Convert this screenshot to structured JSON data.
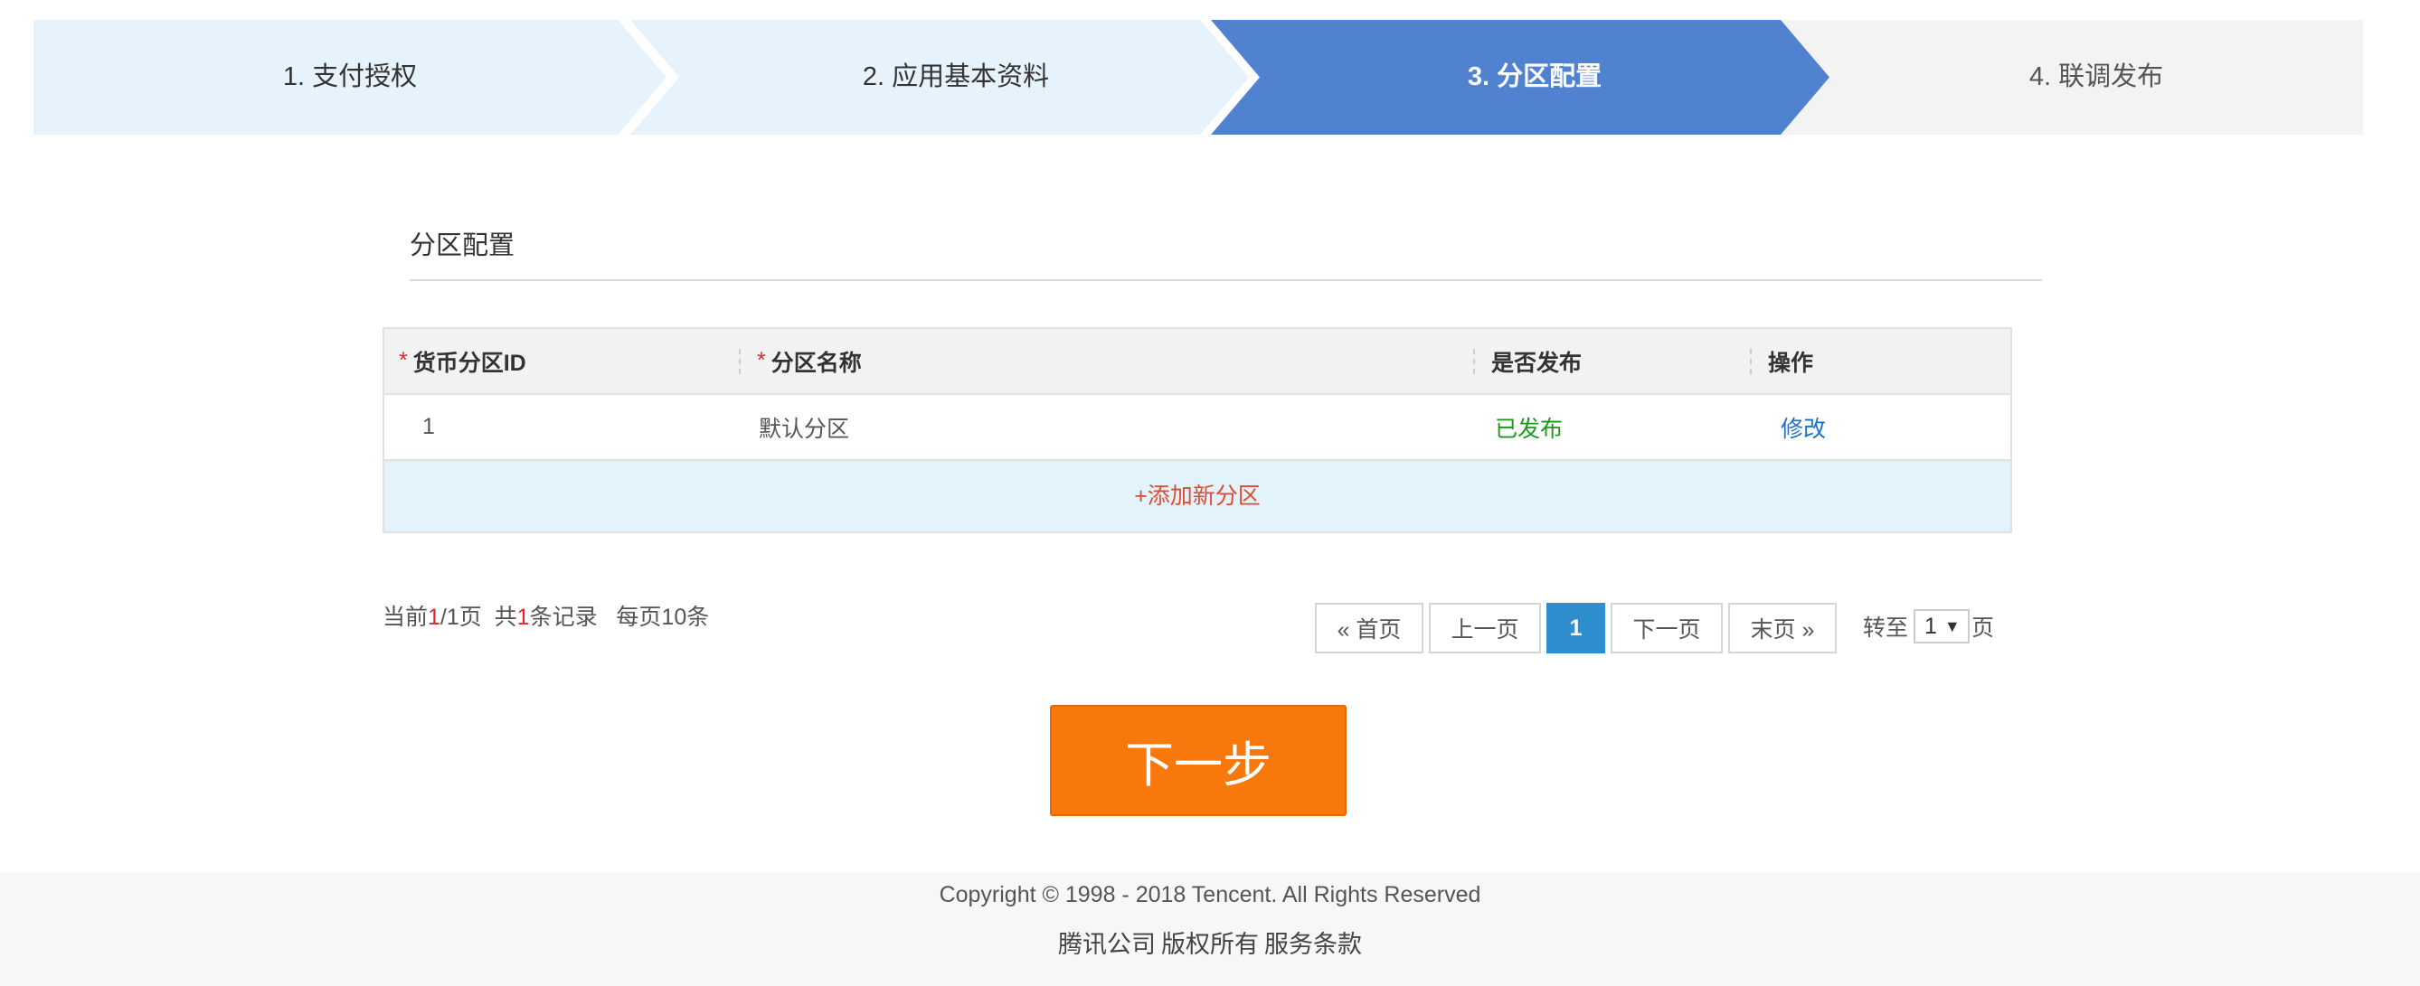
{
  "steps": {
    "items": [
      {
        "label": "1. 支付授权",
        "state": "done"
      },
      {
        "label": "2. 应用基本资料",
        "state": "done"
      },
      {
        "label": "3. 分区配置",
        "state": "active"
      },
      {
        "label": "4. 联调发布",
        "state": "todo"
      }
    ],
    "colors": {
      "done": "#e6f3fc",
      "active": "#5082d0",
      "todo": "#f3f3f3"
    }
  },
  "section": {
    "title": "分区配置"
  },
  "table": {
    "required_mark": "*",
    "columns": [
      "货币分区ID",
      "分区名称",
      "是否发布",
      "操作"
    ],
    "rows": [
      {
        "id": "1",
        "name": "默认分区",
        "status": "已发布",
        "action": "修改"
      }
    ],
    "add_label": "+添加新分区"
  },
  "pagination": {
    "prefix": "当前",
    "current": "1",
    "separator": "/1页  共",
    "total_records": "1",
    "suffix": "条记录   每页10条",
    "buttons": {
      "first": "« 首页",
      "prev": "上一页",
      "page": "1",
      "next": "下一页",
      "last": "末页 »"
    },
    "goto_label": "转至",
    "goto_value": "1",
    "goto_unit": "页"
  },
  "next_button": {
    "label": "下一步",
    "color": "#f8780b"
  },
  "footer": {
    "copyright": "Copyright © 1998 - 2018 Tencent. All Rights Reserved",
    "links": [
      "腾讯公司",
      "版权所有",
      "服务条款"
    ]
  }
}
